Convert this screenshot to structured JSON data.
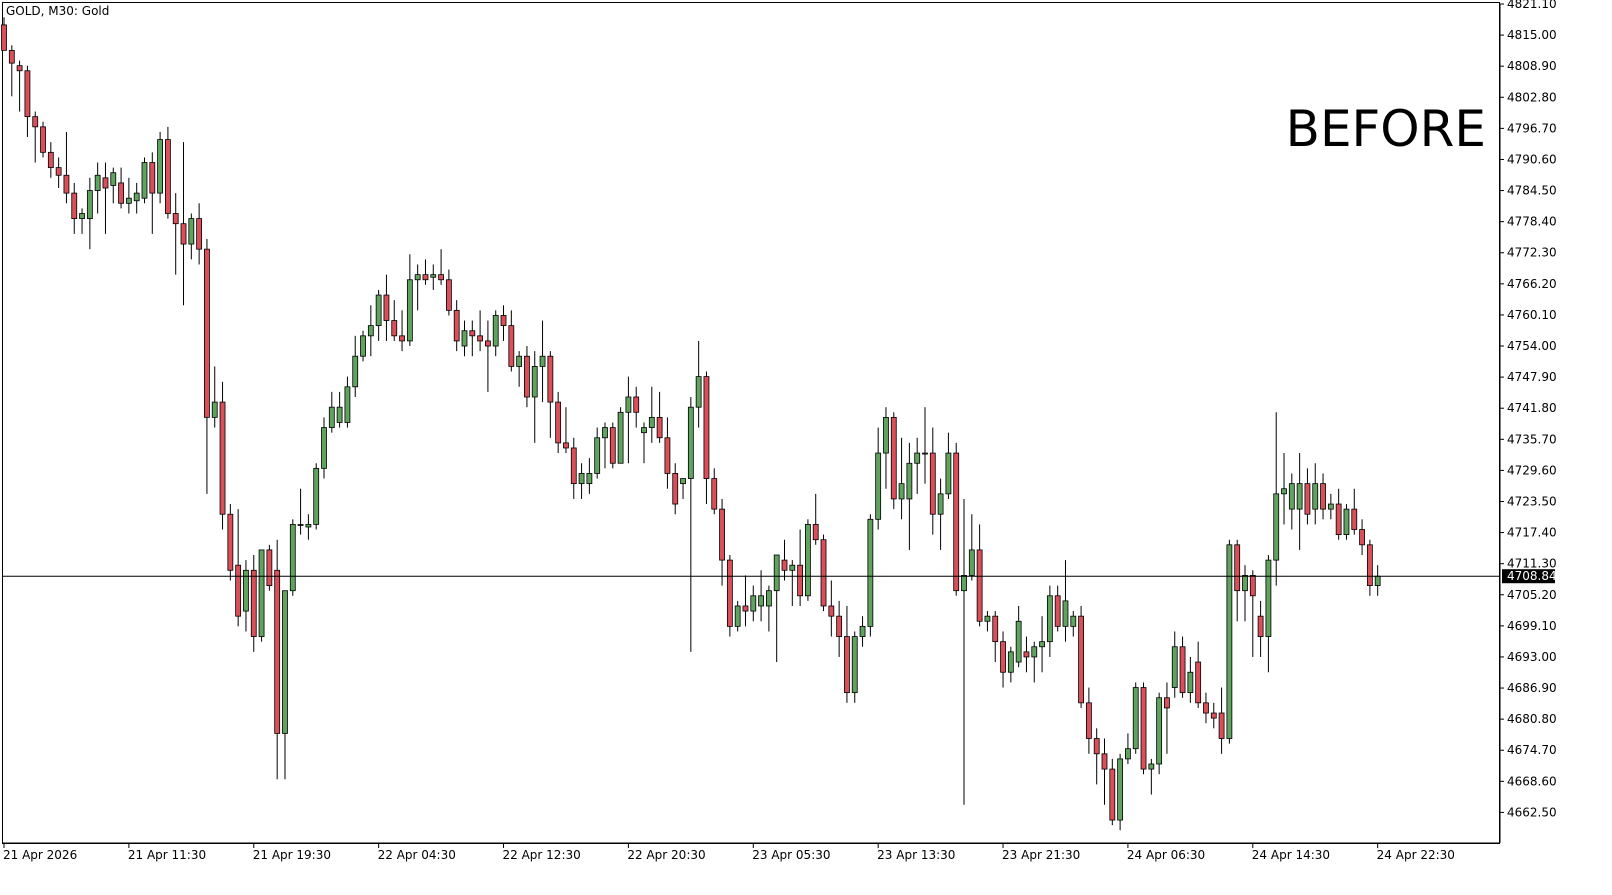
{
  "chart_header": {
    "symbol_label": "GOLD, M30:  Gold"
  },
  "annotation": "BEFORE",
  "colors": {
    "bull": "#5fa35f",
    "bear": "#d9505a",
    "wick": "#000000",
    "background": "#ffffff",
    "axis": "#000000",
    "price_tag_bg": "#000000",
    "price_tag_text": "#ffffff"
  },
  "chart_data": {
    "type": "candlestick",
    "symbol": "GOLD",
    "timeframe": "M30",
    "ylim": [
      4656.5,
      4821.1
    ],
    "y_ticks": [
      "4821.10",
      "4815.00",
      "4808.90",
      "4802.80",
      "4796.70",
      "4790.60",
      "4784.50",
      "4778.40",
      "4772.30",
      "4766.20",
      "4760.10",
      "4754.00",
      "4747.90",
      "4741.80",
      "4735.70",
      "4729.60",
      "4723.50",
      "4717.40",
      "4711.30",
      "4705.20",
      "4699.10",
      "4693.00",
      "4686.90",
      "4680.80",
      "4674.70",
      "4668.60",
      "4662.50"
    ],
    "x_ticks": [
      {
        "label": "21 Apr 2026",
        "index": 0
      },
      {
        "label": "21 Apr 11:30",
        "index": 16
      },
      {
        "label": "21 Apr 19:30",
        "index": 32
      },
      {
        "label": "22 Apr 04:30",
        "index": 48
      },
      {
        "label": "22 Apr 12:30",
        "index": 64
      },
      {
        "label": "22 Apr 20:30",
        "index": 80
      },
      {
        "label": "23 Apr 05:30",
        "index": 96
      },
      {
        "label": "23 Apr 13:30",
        "index": 112
      },
      {
        "label": "23 Apr 21:30",
        "index": 128
      },
      {
        "label": "24 Apr 06:30",
        "index": 144
      },
      {
        "label": "24 Apr 14:30",
        "index": 160
      },
      {
        "label": "24 Apr 22:30",
        "index": 176
      }
    ],
    "current_price": 4708.84,
    "current_price_label": "4708.84",
    "candles": [
      {
        "o": 4817.0,
        "h": 4818.5,
        "l": 4812.0,
        "c": 4812.0
      },
      {
        "o": 4812.0,
        "h": 4813.0,
        "l": 4803.0,
        "c": 4809.5
      },
      {
        "o": 4809.0,
        "h": 4810.0,
        "l": 4800.0,
        "c": 4808.0
      },
      {
        "o": 4808.0,
        "h": 4809.0,
        "l": 4795.0,
        "c": 4799.0
      },
      {
        "o": 4799.0,
        "h": 4800.0,
        "l": 4790.0,
        "c": 4797.0
      },
      {
        "o": 4797.0,
        "h": 4798.0,
        "l": 4791.0,
        "c": 4792.0
      },
      {
        "o": 4792.0,
        "h": 4794.0,
        "l": 4787.0,
        "c": 4789.0
      },
      {
        "o": 4789.0,
        "h": 4791.0,
        "l": 4785.0,
        "c": 4787.5
      },
      {
        "o": 4787.5,
        "h": 4796.0,
        "l": 4782.0,
        "c": 4784.0
      },
      {
        "o": 4784.0,
        "h": 4786.0,
        "l": 4776.0,
        "c": 4779.0
      },
      {
        "o": 4779.0,
        "h": 4781.0,
        "l": 4776.0,
        "c": 4780.0
      },
      {
        "o": 4779.0,
        "h": 4787.0,
        "l": 4773.0,
        "c": 4784.5
      },
      {
        "o": 4784.5,
        "h": 4790.0,
        "l": 4780.0,
        "c": 4787.5
      },
      {
        "o": 4787.0,
        "h": 4790.0,
        "l": 4776.0,
        "c": 4785.0
      },
      {
        "o": 4785.5,
        "h": 4789.0,
        "l": 4782.0,
        "c": 4788.0
      },
      {
        "o": 4786.0,
        "h": 4789.0,
        "l": 4781.0,
        "c": 4782.0
      },
      {
        "o": 4782.0,
        "h": 4787.0,
        "l": 4780.0,
        "c": 4783.0
      },
      {
        "o": 4782.5,
        "h": 4786.0,
        "l": 4780.0,
        "c": 4784.0
      },
      {
        "o": 4783.0,
        "h": 4791.0,
        "l": 4782.0,
        "c": 4790.0
      },
      {
        "o": 4790.0,
        "h": 4792.0,
        "l": 4776.0,
        "c": 4784.0
      },
      {
        "o": 4784.0,
        "h": 4796.0,
        "l": 4782.0,
        "c": 4794.5
      },
      {
        "o": 4794.5,
        "h": 4797.0,
        "l": 4779.0,
        "c": 4780.0
      },
      {
        "o": 4780.0,
        "h": 4784.0,
        "l": 4768.0,
        "c": 4778.0
      },
      {
        "o": 4778.0,
        "h": 4794.0,
        "l": 4762.0,
        "c": 4774.0
      },
      {
        "o": 4774.0,
        "h": 4780.0,
        "l": 4771.0,
        "c": 4779.0
      },
      {
        "o": 4779.0,
        "h": 4782.0,
        "l": 4770.0,
        "c": 4773.0
      },
      {
        "o": 4773.0,
        "h": 4775.0,
        "l": 4725.0,
        "c": 4740.0
      },
      {
        "o": 4740.0,
        "h": 4750.0,
        "l": 4738.0,
        "c": 4743.0
      },
      {
        "o": 4743.0,
        "h": 4747.0,
        "l": 4718.0,
        "c": 4721.0
      },
      {
        "o": 4721.0,
        "h": 4723.0,
        "l": 4708.0,
        "c": 4710.0
      },
      {
        "o": 4711.0,
        "h": 4722.0,
        "l": 4699.0,
        "c": 4701.0
      },
      {
        "o": 4702.0,
        "h": 4712.0,
        "l": 4698.0,
        "c": 4710.0
      },
      {
        "o": 4710.0,
        "h": 4713.0,
        "l": 4694.0,
        "c": 4697.0
      },
      {
        "o": 4697.0,
        "h": 4714.0,
        "l": 4696.0,
        "c": 4714.0
      },
      {
        "o": 4714.0,
        "h": 4715.0,
        "l": 4706.0,
        "c": 4707.0
      },
      {
        "o": 4710.0,
        "h": 4716.0,
        "l": 4669.0,
        "c": 4678.0
      },
      {
        "o": 4678.0,
        "h": 4706.0,
        "l": 4669.0,
        "c": 4706.0
      },
      {
        "o": 4706.0,
        "h": 4720.0,
        "l": 4705.0,
        "c": 4719.0
      },
      {
        "o": 4719.0,
        "h": 4726.0,
        "l": 4717.0,
        "c": 4719.0
      },
      {
        "o": 4718.5,
        "h": 4721.0,
        "l": 4716.0,
        "c": 4719.0
      },
      {
        "o": 4719.0,
        "h": 4731.0,
        "l": 4718.0,
        "c": 4730.0
      },
      {
        "o": 4730.0,
        "h": 4740.0,
        "l": 4728.0,
        "c": 4738.0
      },
      {
        "o": 4738.0,
        "h": 4745.0,
        "l": 4737.0,
        "c": 4742.0
      },
      {
        "o": 4739.0,
        "h": 4745.0,
        "l": 4738.0,
        "c": 4742.0
      },
      {
        "o": 4739.0,
        "h": 4748.0,
        "l": 4738.0,
        "c": 4746.0
      },
      {
        "o": 4746.0,
        "h": 4756.0,
        "l": 4744.0,
        "c": 4752.0
      },
      {
        "o": 4752.0,
        "h": 4757.0,
        "l": 4751.0,
        "c": 4756.0
      },
      {
        "o": 4756.0,
        "h": 4762.0,
        "l": 4752.0,
        "c": 4758.0
      },
      {
        "o": 4758.0,
        "h": 4765.0,
        "l": 4755.0,
        "c": 4764.0
      },
      {
        "o": 4764.0,
        "h": 4768.0,
        "l": 4755.0,
        "c": 4759.0
      },
      {
        "o": 4759.0,
        "h": 4763.0,
        "l": 4755.0,
        "c": 4756.0
      },
      {
        "o": 4756.0,
        "h": 4761.0,
        "l": 4753.0,
        "c": 4755.0
      },
      {
        "o": 4755.0,
        "h": 4772.0,
        "l": 4754.0,
        "c": 4767.0
      },
      {
        "o": 4767.0,
        "h": 4770.0,
        "l": 4761.0,
        "c": 4768.0
      },
      {
        "o": 4768.0,
        "h": 4771.0,
        "l": 4766.0,
        "c": 4767.0
      },
      {
        "o": 4767.5,
        "h": 4770.0,
        "l": 4765.0,
        "c": 4768.0
      },
      {
        "o": 4768.0,
        "h": 4773.0,
        "l": 4766.0,
        "c": 4767.0
      },
      {
        "o": 4767.0,
        "h": 4769.0,
        "l": 4760.0,
        "c": 4761.0
      },
      {
        "o": 4761.0,
        "h": 4763.0,
        "l": 4753.0,
        "c": 4755.0
      },
      {
        "o": 4754.0,
        "h": 4759.0,
        "l": 4752.0,
        "c": 4757.0
      },
      {
        "o": 4757.0,
        "h": 4759.0,
        "l": 4752.0,
        "c": 4756.0
      },
      {
        "o": 4756.0,
        "h": 4761.0,
        "l": 4753.0,
        "c": 4755.0
      },
      {
        "o": 4755.0,
        "h": 4759.0,
        "l": 4745.0,
        "c": 4754.0
      },
      {
        "o": 4754.0,
        "h": 4761.0,
        "l": 4752.0,
        "c": 4760.0
      },
      {
        "o": 4760.0,
        "h": 4762.0,
        "l": 4755.0,
        "c": 4758.0
      },
      {
        "o": 4758.0,
        "h": 4761.0,
        "l": 4749.0,
        "c": 4750.0
      },
      {
        "o": 4750.0,
        "h": 4753.0,
        "l": 4746.0,
        "c": 4752.0
      },
      {
        "o": 4752.0,
        "h": 4754.0,
        "l": 4742.0,
        "c": 4744.0
      },
      {
        "o": 4744.0,
        "h": 4753.0,
        "l": 4735.0,
        "c": 4750.0
      },
      {
        "o": 4750.0,
        "h": 4759.0,
        "l": 4743.0,
        "c": 4752.0
      },
      {
        "o": 4752.0,
        "h": 4753.0,
        "l": 4736.0,
        "c": 4743.0
      },
      {
        "o": 4743.0,
        "h": 4745.0,
        "l": 4733.0,
        "c": 4735.0
      },
      {
        "o": 4735.0,
        "h": 4742.0,
        "l": 4733.0,
        "c": 4734.0
      },
      {
        "o": 4734.0,
        "h": 4736.0,
        "l": 4724.0,
        "c": 4727.0
      },
      {
        "o": 4727.0,
        "h": 4731.0,
        "l": 4724.0,
        "c": 4729.0
      },
      {
        "o": 4727.0,
        "h": 4732.0,
        "l": 4725.0,
        "c": 4729.0
      },
      {
        "o": 4729.0,
        "h": 4738.0,
        "l": 4728.0,
        "c": 4736.0
      },
      {
        "o": 4736.0,
        "h": 4739.0,
        "l": 4730.0,
        "c": 4738.0
      },
      {
        "o": 4738.0,
        "h": 4739.0,
        "l": 4730.0,
        "c": 4731.0
      },
      {
        "o": 4731.0,
        "h": 4742.0,
        "l": 4731.0,
        "c": 4741.0
      },
      {
        "o": 4741.0,
        "h": 4748.0,
        "l": 4731.0,
        "c": 4744.0
      },
      {
        "o": 4744.0,
        "h": 4746.0,
        "l": 4738.0,
        "c": 4741.0
      },
      {
        "o": 4737.0,
        "h": 4739.0,
        "l": 4731.0,
        "c": 4738.0
      },
      {
        "o": 4738.0,
        "h": 4746.0,
        "l": 4735.0,
        "c": 4740.0
      },
      {
        "o": 4740.0,
        "h": 4745.0,
        "l": 4735.0,
        "c": 4736.0
      },
      {
        "o": 4736.0,
        "h": 4740.0,
        "l": 4726.0,
        "c": 4729.0
      },
      {
        "o": 4729.0,
        "h": 4731.0,
        "l": 4721.0,
        "c": 4723.0
      },
      {
        "o": 4727.0,
        "h": 4728.0,
        "l": 4724.0,
        "c": 4728.0
      },
      {
        "o": 4728.0,
        "h": 4744.0,
        "l": 4694.0,
        "c": 4742.0
      },
      {
        "o": 4742.0,
        "h": 4755.0,
        "l": 4738.0,
        "c": 4748.0
      },
      {
        "o": 4748.0,
        "h": 4749.0,
        "l": 4723.0,
        "c": 4728.0
      },
      {
        "o": 4728.0,
        "h": 4730.0,
        "l": 4721.0,
        "c": 4722.0
      },
      {
        "o": 4722.0,
        "h": 4724.0,
        "l": 4707.0,
        "c": 4712.0
      },
      {
        "o": 4712.0,
        "h": 4713.0,
        "l": 4697.0,
        "c": 4699.0
      },
      {
        "o": 4699.0,
        "h": 4704.0,
        "l": 4698.0,
        "c": 4703.0
      },
      {
        "o": 4703.0,
        "h": 4709.0,
        "l": 4699.0,
        "c": 4702.0
      },
      {
        "o": 4702.0,
        "h": 4707.0,
        "l": 4700.0,
        "c": 4705.0
      },
      {
        "o": 4703.0,
        "h": 4710.0,
        "l": 4700.0,
        "c": 4705.0
      },
      {
        "o": 4703.0,
        "h": 4707.0,
        "l": 4698.0,
        "c": 4706.0
      },
      {
        "o": 4706.0,
        "h": 4713.0,
        "l": 4692.0,
        "c": 4713.0
      },
      {
        "o": 4712.0,
        "h": 4716.0,
        "l": 4708.0,
        "c": 4710.0
      },
      {
        "o": 4710.0,
        "h": 4712.0,
        "l": 4703.0,
        "c": 4711.0
      },
      {
        "o": 4711.0,
        "h": 4718.0,
        "l": 4703.0,
        "c": 4705.0
      },
      {
        "o": 4705.0,
        "h": 4720.0,
        "l": 4704.0,
        "c": 4719.0
      },
      {
        "o": 4719.0,
        "h": 4725.0,
        "l": 4715.0,
        "c": 4716.0
      },
      {
        "o": 4716.0,
        "h": 4717.0,
        "l": 4702.0,
        "c": 4703.0
      },
      {
        "o": 4703.0,
        "h": 4708.0,
        "l": 4697.0,
        "c": 4701.0
      },
      {
        "o": 4701.0,
        "h": 4704.0,
        "l": 4693.0,
        "c": 4697.0
      },
      {
        "o": 4697.0,
        "h": 4703.0,
        "l": 4684.0,
        "c": 4686.0
      },
      {
        "o": 4686.0,
        "h": 4698.0,
        "l": 4684.0,
        "c": 4697.0
      },
      {
        "o": 4697.0,
        "h": 4701.0,
        "l": 4695.0,
        "c": 4699.0
      },
      {
        "o": 4699.0,
        "h": 4721.0,
        "l": 4697.0,
        "c": 4720.0
      },
      {
        "o": 4720.0,
        "h": 4738.0,
        "l": 4718.0,
        "c": 4733.0
      },
      {
        "o": 4733.0,
        "h": 4742.0,
        "l": 4726.0,
        "c": 4740.0
      },
      {
        "o": 4740.0,
        "h": 4741.0,
        "l": 4722.0,
        "c": 4724.0
      },
      {
        "o": 4724.0,
        "h": 4736.0,
        "l": 4720.0,
        "c": 4727.0
      },
      {
        "o": 4724.0,
        "h": 4735.0,
        "l": 4714.0,
        "c": 4731.0
      },
      {
        "o": 4731.0,
        "h": 4736.0,
        "l": 4725.0,
        "c": 4733.0
      },
      {
        "o": 4733.0,
        "h": 4742.0,
        "l": 4727.0,
        "c": 4733.0
      },
      {
        "o": 4733.0,
        "h": 4738.0,
        "l": 4717.0,
        "c": 4721.0
      },
      {
        "o": 4721.0,
        "h": 4728.0,
        "l": 4714.0,
        "c": 4725.0
      },
      {
        "o": 4725.0,
        "h": 4737.0,
        "l": 4724.0,
        "c": 4733.0
      },
      {
        "o": 4733.0,
        "h": 4735.0,
        "l": 4705.0,
        "c": 4706.0
      },
      {
        "o": 4706.0,
        "h": 4724.0,
        "l": 4664.0,
        "c": 4709.0
      },
      {
        "o": 4709.0,
        "h": 4721.0,
        "l": 4708.0,
        "c": 4714.0
      },
      {
        "o": 4714.0,
        "h": 4719.0,
        "l": 4699.0,
        "c": 4700.0
      },
      {
        "o": 4700.0,
        "h": 4702.0,
        "l": 4698.0,
        "c": 4701.0
      },
      {
        "o": 4701.0,
        "h": 4702.0,
        "l": 4692.0,
        "c": 4696.0
      },
      {
        "o": 4696.0,
        "h": 4698.0,
        "l": 4687.0,
        "c": 4690.0
      },
      {
        "o": 4690.0,
        "h": 4695.0,
        "l": 4688.0,
        "c": 4694.0
      },
      {
        "o": 4692.0,
        "h": 4703.0,
        "l": 4691.0,
        "c": 4700.0
      },
      {
        "o": 4694.0,
        "h": 4697.0,
        "l": 4690.0,
        "c": 4693.0
      },
      {
        "o": 4693.0,
        "h": 4696.0,
        "l": 4688.0,
        "c": 4695.0
      },
      {
        "o": 4695.0,
        "h": 4701.0,
        "l": 4690.0,
        "c": 4696.0
      },
      {
        "o": 4696.0,
        "h": 4707.0,
        "l": 4693.0,
        "c": 4705.0
      },
      {
        "o": 4705.0,
        "h": 4707.0,
        "l": 4698.0,
        "c": 4699.0
      },
      {
        "o": 4699.0,
        "h": 4712.0,
        "l": 4696.0,
        "c": 4704.0
      },
      {
        "o": 4699.0,
        "h": 4702.0,
        "l": 4697.0,
        "c": 4701.0
      },
      {
        "o": 4701.0,
        "h": 4703.0,
        "l": 4683.0,
        "c": 4684.0
      },
      {
        "o": 4684.0,
        "h": 4687.0,
        "l": 4674.0,
        "c": 4677.0
      },
      {
        "o": 4677.0,
        "h": 4679.0,
        "l": 4668.0,
        "c": 4674.0
      },
      {
        "o": 4674.0,
        "h": 4677.0,
        "l": 4664.0,
        "c": 4671.0
      },
      {
        "o": 4671.0,
        "h": 4673.0,
        "l": 4660.0,
        "c": 4661.0
      },
      {
        "o": 4661.0,
        "h": 4674.0,
        "l": 4659.0,
        "c": 4673.0
      },
      {
        "o": 4673.0,
        "h": 4678.0,
        "l": 4672.0,
        "c": 4675.0
      },
      {
        "o": 4675.0,
        "h": 4688.0,
        "l": 4674.0,
        "c": 4687.0
      },
      {
        "o": 4687.0,
        "h": 4688.0,
        "l": 4670.0,
        "c": 4671.0
      },
      {
        "o": 4671.0,
        "h": 4673.0,
        "l": 4666.0,
        "c": 4672.0
      },
      {
        "o": 4672.0,
        "h": 4686.0,
        "l": 4670.0,
        "c": 4685.0
      },
      {
        "o": 4685.0,
        "h": 4688.0,
        "l": 4674.0,
        "c": 4683.0
      },
      {
        "o": 4687.0,
        "h": 4698.0,
        "l": 4685.0,
        "c": 4695.0
      },
      {
        "o": 4695.0,
        "h": 4697.0,
        "l": 4685.0,
        "c": 4686.0
      },
      {
        "o": 4686.0,
        "h": 4693.0,
        "l": 4684.0,
        "c": 4690.0
      },
      {
        "o": 4692.0,
        "h": 4696.0,
        "l": 4683.0,
        "c": 4684.0
      },
      {
        "o": 4684.0,
        "h": 4686.0,
        "l": 4680.0,
        "c": 4682.0
      },
      {
        "o": 4682.0,
        "h": 4684.0,
        "l": 4679.0,
        "c": 4681.0
      },
      {
        "o": 4682.0,
        "h": 4687.0,
        "l": 4674.0,
        "c": 4677.0
      },
      {
        "o": 4677.0,
        "h": 4716.0,
        "l": 4676.0,
        "c": 4715.0
      },
      {
        "o": 4715.0,
        "h": 4716.0,
        "l": 4700.0,
        "c": 4706.0
      },
      {
        "o": 4706.0,
        "h": 4711.0,
        "l": 4700.0,
        "c": 4709.0
      },
      {
        "o": 4709.0,
        "h": 4710.0,
        "l": 4693.0,
        "c": 4705.0
      },
      {
        "o": 4701.0,
        "h": 4704.0,
        "l": 4693.0,
        "c": 4697.0
      },
      {
        "o": 4697.0,
        "h": 4713.0,
        "l": 4690.0,
        "c": 4712.0
      },
      {
        "o": 4712.0,
        "h": 4741.0,
        "l": 4707.0,
        "c": 4725.0
      },
      {
        "o": 4725.0,
        "h": 4733.0,
        "l": 4719.0,
        "c": 4726.0
      },
      {
        "o": 4722.0,
        "h": 4729.0,
        "l": 4718.0,
        "c": 4727.0
      },
      {
        "o": 4722.0,
        "h": 4733.0,
        "l": 4714.0,
        "c": 4727.0
      },
      {
        "o": 4727.0,
        "h": 4730.0,
        "l": 4719.0,
        "c": 4721.0
      },
      {
        "o": 4722.0,
        "h": 4731.0,
        "l": 4719.0,
        "c": 4727.0
      },
      {
        "o": 4727.0,
        "h": 4729.0,
        "l": 4720.0,
        "c": 4722.0
      },
      {
        "o": 4722.0,
        "h": 4725.0,
        "l": 4720.0,
        "c": 4723.0
      },
      {
        "o": 4723.0,
        "h": 4726.0,
        "l": 4716.0,
        "c": 4717.0
      },
      {
        "o": 4717.0,
        "h": 4723.0,
        "l": 4716.0,
        "c": 4722.0
      },
      {
        "o": 4722.0,
        "h": 4726.0,
        "l": 4717.0,
        "c": 4718.0
      },
      {
        "o": 4718.0,
        "h": 4720.0,
        "l": 4713.0,
        "c": 4715.0
      },
      {
        "o": 4715.0,
        "h": 4716.0,
        "l": 4705.0,
        "c": 4707.0
      },
      {
        "o": 4707.0,
        "h": 4711.0,
        "l": 4705.0,
        "c": 4708.84
      }
    ]
  }
}
